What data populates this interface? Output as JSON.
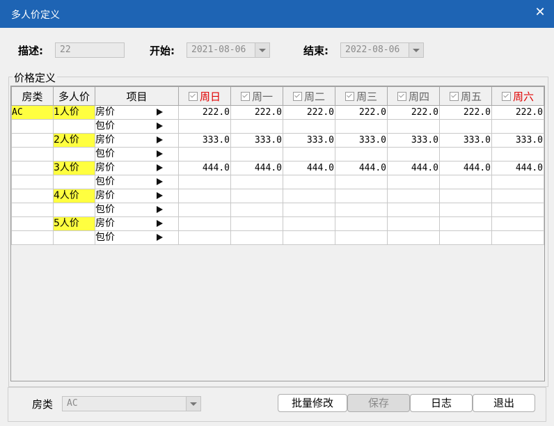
{
  "window": {
    "title": "多人价定义",
    "close_icon": "close-icon"
  },
  "form": {
    "desc_label": "描述:",
    "desc_value": "22",
    "start_label": "开始:",
    "start_value": "2021-08-06",
    "end_label": "结束:",
    "end_value": "2022-08-06"
  },
  "group": {
    "title": "价格定义"
  },
  "table": {
    "headers": {
      "room_type": "房类",
      "multi_price": "多人价",
      "item": "项目"
    },
    "days": [
      {
        "label": "周日",
        "checked": true,
        "highlight": "#e00000"
      },
      {
        "label": "周一",
        "checked": true,
        "highlight": ""
      },
      {
        "label": "周二",
        "checked": true,
        "highlight": ""
      },
      {
        "label": "周三",
        "checked": true,
        "highlight": ""
      },
      {
        "label": "周四",
        "checked": true,
        "highlight": ""
      },
      {
        "label": "周五",
        "checked": true,
        "highlight": ""
      },
      {
        "label": "周六",
        "checked": true,
        "highlight": "#e00000"
      }
    ],
    "rows": [
      {
        "room": "AC",
        "multi": "1人价",
        "item": "房价",
        "values": [
          "222.0",
          "222.0",
          "222.0",
          "222.0",
          "222.0",
          "222.0",
          "222.0"
        ]
      },
      {
        "room": "",
        "multi": "",
        "item": "包价",
        "values": [
          "",
          "",
          "",
          "",
          "",
          "",
          ""
        ]
      },
      {
        "room": "",
        "multi": "2人价",
        "item": "房价",
        "values": [
          "333.0",
          "333.0",
          "333.0",
          "333.0",
          "333.0",
          "333.0",
          "333.0"
        ]
      },
      {
        "room": "",
        "multi": "",
        "item": "包价",
        "values": [
          "",
          "",
          "",
          "",
          "",
          "",
          ""
        ]
      },
      {
        "room": "",
        "multi": "3人价",
        "item": "房价",
        "values": [
          "444.0",
          "444.0",
          "444.0",
          "444.0",
          "444.0",
          "444.0",
          "444.0"
        ]
      },
      {
        "room": "",
        "multi": "",
        "item": "包价",
        "values": [
          "",
          "",
          "",
          "",
          "",
          "",
          ""
        ]
      },
      {
        "room": "",
        "multi": "4人价",
        "item": "房价",
        "values": [
          "",
          "",
          "",
          "",
          "",
          "",
          ""
        ]
      },
      {
        "room": "",
        "multi": "",
        "item": "包价",
        "values": [
          "",
          "",
          "",
          "",
          "",
          "",
          ""
        ]
      },
      {
        "room": "",
        "multi": "5人价",
        "item": "房价",
        "values": [
          "",
          "",
          "",
          "",
          "",
          "",
          ""
        ]
      },
      {
        "room": "",
        "multi": "",
        "item": "包价",
        "values": [
          "",
          "",
          "",
          "",
          "",
          "",
          ""
        ]
      }
    ]
  },
  "footer": {
    "room_type_label": "房类",
    "room_type_value": "AC",
    "batch_edit": "批量修改",
    "save": "保存",
    "log": "日志",
    "exit": "退出"
  },
  "colors": {
    "titlebar": "#1e64b4",
    "highlight": "#ffff40",
    "weekend": "#e00000"
  }
}
